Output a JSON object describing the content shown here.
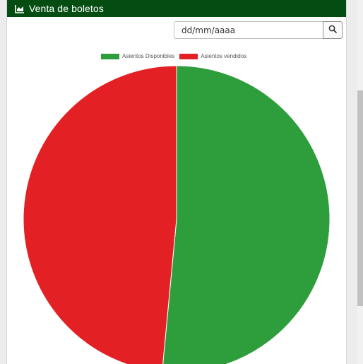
{
  "header": {
    "title": "Venta de boletos",
    "icon": "area-chart-icon"
  },
  "date_filter": {
    "placeholder": "dd/mm/aaaa",
    "button_icon": "search-icon"
  },
  "colors": {
    "header_bg": "#044d12",
    "available": "#2e9e3c",
    "sold": "#e32124"
  },
  "chart_data": {
    "type": "pie",
    "labels": [
      "Asientos Disponibles",
      "Asientos vendidos"
    ],
    "values": [
      51.5,
      48.5
    ],
    "colors": [
      "#2e9e3c",
      "#e32124"
    ],
    "legend_position": "top",
    "start_angle": "top",
    "direction": "clockwise"
  }
}
